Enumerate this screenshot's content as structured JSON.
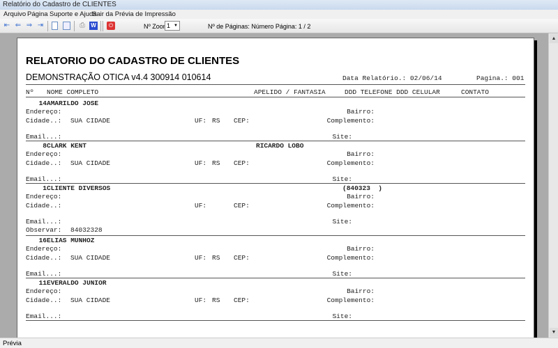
{
  "window": {
    "title": "Relatório do Cadastro de CLIENTES"
  },
  "menu": [
    "Arquivo",
    "Página",
    "Suporte e Ajuda",
    "Sair da Prévia de Impressão"
  ],
  "toolbar": {
    "zoom_label": "Nº Zoom",
    "zoom_value": "1",
    "pages_label": "Nº de Páginas: Número Página: 1 / 2"
  },
  "report": {
    "title": "RELATORIO DO CADASTRO DE CLIENTES",
    "subtitle": "DEMONSTRAÇÃO OTICA v4.4 300914 010614",
    "date": "Data Relatório.: 02/06/14",
    "page": "Pagina.: 001",
    "headers": {
      "num": "Nº",
      "name": "NOME COMPLETO",
      "alias": "APELIDO / FANTASIA",
      "phones": "DDD TELEFONE DDD CELULAR",
      "contact": "CONTATO"
    },
    "labels": {
      "address": "Endereço:",
      "city": "Cidade..:",
      "uf": "UF:",
      "cep": "CEP:",
      "email": "Email...:",
      "bairro": "Bairro:",
      "complement": "Complemento:",
      "site": "Site:",
      "obs": "Observar:"
    },
    "records": [
      {
        "num": "14",
        "name": "AMARILDO JOSE",
        "alias": "",
        "phone": "",
        "city": "SUA CIDADE",
        "uf": "RS",
        "obs": ""
      },
      {
        "num": "8",
        "name": "CLARK KENT",
        "alias": "RICARDO LOBO",
        "phone": "",
        "city": "SUA CIDADE",
        "uf": "RS",
        "obs": ""
      },
      {
        "num": "1",
        "name": "CLIENTE DIVERSOS",
        "alias": "",
        "phone": "(840323  )",
        "city": "",
        "uf": "",
        "obs": "84032328"
      },
      {
        "num": "16",
        "name": "ELIAS MUNHOZ",
        "alias": "",
        "phone": "",
        "city": "SUA CIDADE",
        "uf": "RS",
        "obs": ""
      },
      {
        "num": "11",
        "name": "EVERALDO JUNIOR",
        "alias": "",
        "phone": "",
        "city": "SUA CIDADE",
        "uf": "RS",
        "obs": ""
      }
    ]
  },
  "status": "Prévia"
}
